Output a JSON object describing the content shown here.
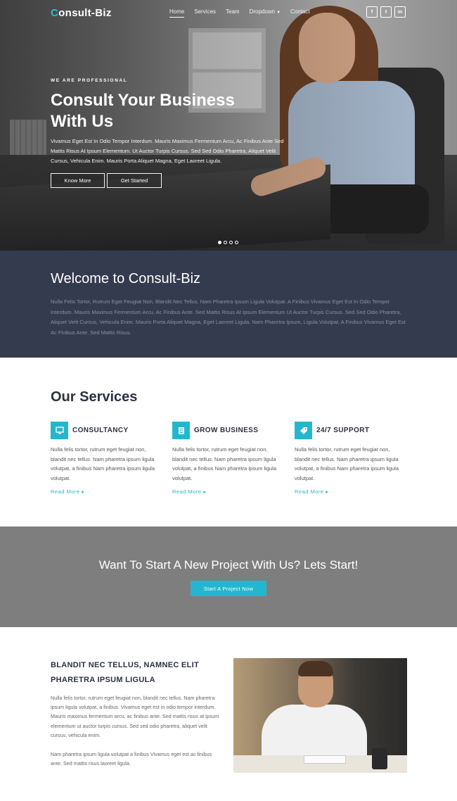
{
  "header": {
    "logo_initial": "C",
    "logo_rest": "onsult-Biz",
    "nav": [
      "Home",
      "Services",
      "Team",
      "Dropdown",
      "Contact"
    ],
    "social": [
      "f",
      "t",
      "in"
    ]
  },
  "hero": {
    "tagline": "WE ARE PROFESSIONAL",
    "title": "Consult Your Business With Us",
    "text": "Vivamus Eget Est In Odio Tempor Interdum. Mauris Maximus Fermentum Arcu, Ac Finibus Ante Sed Mattis Risus At Ipsum Elementum. Ut Auctor Turpis Cursus. Sed Sed Odio Pharetra, Aliquet Velit Cursus, Vehicula Enim. Mauris Porta Aliquet Magna, Eget Laoreet Ligula.",
    "btn_know": "Know More",
    "btn_start": "Get Started",
    "slide_active": 1,
    "slide_count": 4
  },
  "welcome": {
    "title": "Welcome to Consult-Biz",
    "text": "Nulla Felis Tortor, Rutrum Eget Feugiat Non, Blandit Nec Tellus. Nam Pharetra Ipsum Ligula Volutpat. A Finibus Vivamus Eget Est In Odio Tempor Interdum. Mauris Maximus Fermentum Arcu, Ac Finibus Ante. Sed Mattis Risus At Ipsum Elementum Ut Auctor Turpis Cursus. Sed Sed Odio Pharetra, Aliquet Velit Cursus, Vehicula Enim. Mauris Porta Aliquet Magna, Eget Laoreet Ligula. Nam Pharetra Ipsum, Ligula Volutpat. A Finibus Vivamus Eget Est Ac Finibus Ante. Sed Mattis Risus."
  },
  "services": {
    "title": "Our Services",
    "items": [
      {
        "name": "CONSULTANCY",
        "icon": "monitor-icon",
        "desc": "Nulla felis tortor, rutrum eget feugiat non, blandit nec tellus. Nam pharetra ipsum ligula volutpat, a finibus Nam pharetra ipsum ligula volutpat.",
        "more": "Read More"
      },
      {
        "name": "GROW BUSINESS",
        "icon": "document-icon",
        "desc": "Nulla felis tortor, rutrum eget feugiat non, blandit nec tellus. Nam pharetra ipsum ligula volutpat, a finibus Nam pharetra ipsum ligula volutpat.",
        "more": "Read More"
      },
      {
        "name": "24/7 SUPPORT",
        "icon": "tag-icon",
        "desc": "Nulla felis tortor, rutrum eget feugiat non, blandit nec tellus. Nam pharetra ipsum ligula volutpat, a finibus Nam pharetra ipsum ligula volutpat.",
        "more": "Read More"
      }
    ]
  },
  "cta": {
    "title": "Want To Start A New Project With Us? Lets Start!",
    "button": "Start A Project Now"
  },
  "about": {
    "title": "BLANDIT NEC TELLUS, NAMNEC ELIT PHARETRA IPSUM LIGULA",
    "p1": "Nulla felis tortor, rutrum eget feugiat non, blandit nec tellus. Nam pharetra ipsum ligula volutpat, a finibus. Vivamus eget est in odio tempor interdum. Mauris maximus fermentum arcu, ac finibus ante. Sed mattis risus at ipsum elementum ut auctor turpis cursus. Sed sed odio pharetra, aliquet velit cursus, vehicula enim.",
    "p2": "Nam pharetra ipsum ligula volutpat a finibus Vivamus eget est ac finibus ante. Sed mattis risus laoreet ligula."
  },
  "colors": {
    "accent": "#23b7cf",
    "navy": "#353b4f",
    "cta_gray": "#7e7e7e"
  }
}
